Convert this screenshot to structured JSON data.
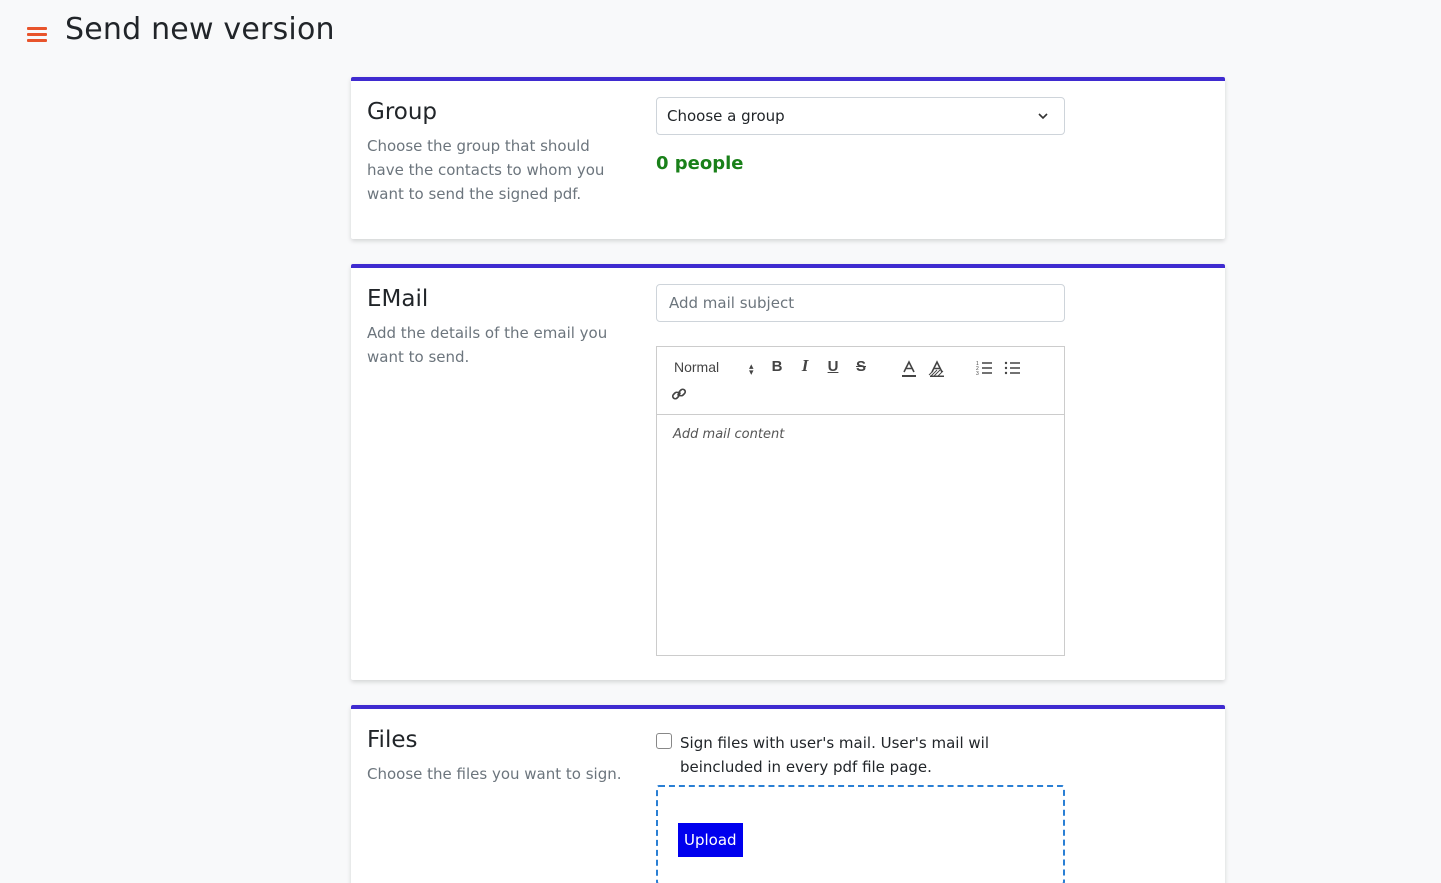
{
  "header": {
    "title": "Send new version",
    "menu_icon": "hamburger-menu-icon",
    "accent_color": "#e8542b"
  },
  "group_section": {
    "title": "Group",
    "description": "Choose the group that should have the contacts to whom you want to send the signed pdf.",
    "select": {
      "selected": "Choose a group",
      "icon": "chevron-down-icon"
    },
    "people_count": "0 people"
  },
  "email_section": {
    "title": "EMail",
    "description": "Add the details of the email you want to send.",
    "subject_placeholder": "Add mail subject",
    "editor": {
      "heading_select": "Normal",
      "toolbar_icons": [
        "bold-icon",
        "italic-icon",
        "underline-icon",
        "strikethrough-icon",
        "text-color-icon",
        "background-color-icon",
        "ordered-list-icon",
        "bullet-list-icon",
        "link-icon"
      ],
      "content_placeholder": "Add mail content"
    }
  },
  "files_section": {
    "title": "Files",
    "description": "Choose the files you want to sign.",
    "checkbox_label": "Sign files with user's mail. User's mail wil beincluded in every pdf file page.",
    "checkbox_checked": false,
    "upload_label": "Upload"
  },
  "colors": {
    "card_border": "#3f2bd0",
    "people_text": "#198019",
    "upload_button": "#0000ee",
    "dropzone_border": "#2a7fd4"
  }
}
